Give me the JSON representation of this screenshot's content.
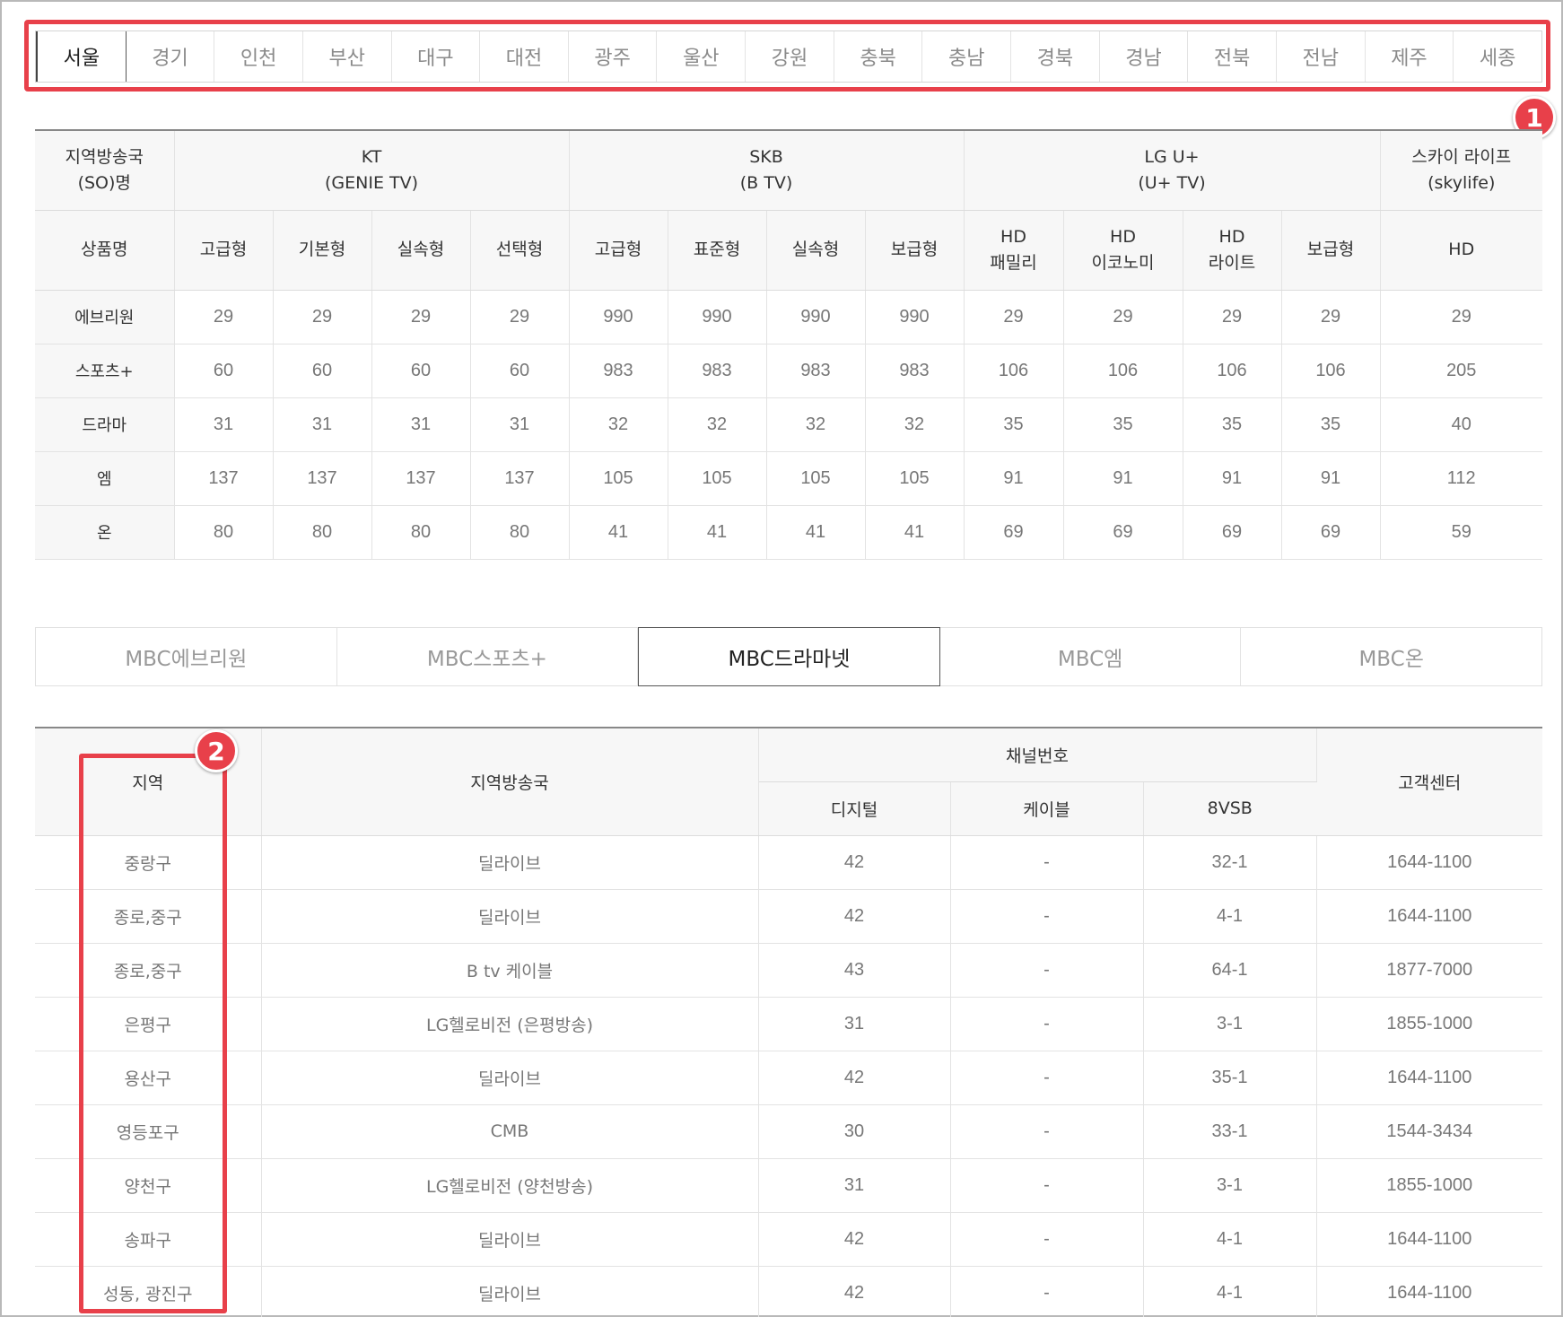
{
  "regions": [
    "서울",
    "경기",
    "인천",
    "부산",
    "대구",
    "대전",
    "광주",
    "울산",
    "강원",
    "충북",
    "충남",
    "경북",
    "경남",
    "전북",
    "전남",
    "제주",
    "세종"
  ],
  "active_region": "서울",
  "badges": {
    "one": "1",
    "two": "2"
  },
  "price_table": {
    "so_header": [
      "지역방송국",
      "(SO)명"
    ],
    "providers": [
      {
        "line1": "KT",
        "line2": "(GENIE TV)"
      },
      {
        "line1": "SKB",
        "line2": "(B TV)"
      },
      {
        "line1": "LG U+",
        "line2": "(U+ TV)"
      },
      {
        "line1": "스카이 라이프",
        "line2": "(skylife)"
      }
    ],
    "product_label": "상품명",
    "products": [
      [
        "고급형"
      ],
      [
        "기본형"
      ],
      [
        "실속형"
      ],
      [
        "선택형"
      ],
      [
        "고급형"
      ],
      [
        "표준형"
      ],
      [
        "실속형"
      ],
      [
        "보급형"
      ],
      [
        "HD",
        "패밀리"
      ],
      [
        "HD",
        "이코노미"
      ],
      [
        "HD",
        "라이트"
      ],
      [
        "보급형"
      ],
      [
        "HD"
      ]
    ],
    "rows": [
      {
        "name": "에브리원",
        "values": [
          "29",
          "29",
          "29",
          "29",
          "990",
          "990",
          "990",
          "990",
          "29",
          "29",
          "29",
          "29",
          "29"
        ]
      },
      {
        "name": "스포츠+",
        "values": [
          "60",
          "60",
          "60",
          "60",
          "983",
          "983",
          "983",
          "983",
          "106",
          "106",
          "106",
          "106",
          "205"
        ]
      },
      {
        "name": "드라마",
        "values": [
          "31",
          "31",
          "31",
          "31",
          "32",
          "32",
          "32",
          "32",
          "35",
          "35",
          "35",
          "35",
          "40"
        ]
      },
      {
        "name": "엠",
        "values": [
          "137",
          "137",
          "137",
          "137",
          "105",
          "105",
          "105",
          "105",
          "91",
          "91",
          "91",
          "91",
          "112"
        ]
      },
      {
        "name": "온",
        "values": [
          "80",
          "80",
          "80",
          "80",
          "41",
          "41",
          "41",
          "41",
          "69",
          "69",
          "69",
          "69",
          "59"
        ]
      }
    ]
  },
  "channel_tabs": [
    "MBC에브리원",
    "MBC스포츠+",
    "MBC드라마넷",
    "MBC엠",
    "MBC온"
  ],
  "active_channel_tab": "MBC드라마넷",
  "channel_table": {
    "headers": {
      "region": "지역",
      "station": "지역방송국",
      "channel_number": "채널번호",
      "digital": "디지털",
      "cable": "케이블",
      "vsb": "8VSB",
      "customer_center": "고객센터"
    },
    "rows": [
      {
        "region": "중랑구",
        "station": "딜라이브",
        "digital": "42",
        "cable": "-",
        "vsb": "32-1",
        "phone": "1644-1100"
      },
      {
        "region": "종로,중구",
        "station": "딜라이브",
        "digital": "42",
        "cable": "-",
        "vsb": "4-1",
        "phone": "1644-1100"
      },
      {
        "region": "종로,중구",
        "station": "B tv 케이블",
        "digital": "43",
        "cable": "-",
        "vsb": "64-1",
        "phone": "1877-7000"
      },
      {
        "region": "은평구",
        "station": "LG헬로비전 (은평방송)",
        "digital": "31",
        "cable": "-",
        "vsb": "3-1",
        "phone": "1855-1000"
      },
      {
        "region": "용산구",
        "station": "딜라이브",
        "digital": "42",
        "cable": "-",
        "vsb": "35-1",
        "phone": "1644-1100"
      },
      {
        "region": "영등포구",
        "station": "CMB",
        "digital": "30",
        "cable": "-",
        "vsb": "33-1",
        "phone": "1544-3434"
      },
      {
        "region": "양천구",
        "station": "LG헬로비전 (양천방송)",
        "digital": "31",
        "cable": "-",
        "vsb": "3-1",
        "phone": "1855-1000"
      },
      {
        "region": "송파구",
        "station": "딜라이브",
        "digital": "42",
        "cable": "-",
        "vsb": "4-1",
        "phone": "1644-1100"
      },
      {
        "region": "성동, 광진구",
        "station": "딜라이브",
        "digital": "42",
        "cable": "-",
        "vsb": "4-1",
        "phone": "1644-1100"
      }
    ]
  },
  "colors": {
    "highlight": "#e8404a",
    "active_border": "#444444",
    "muted_text": "#777777"
  }
}
